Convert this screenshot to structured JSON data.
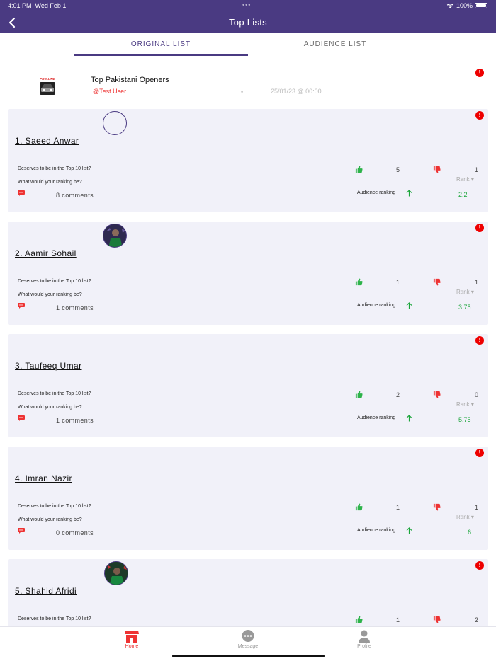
{
  "status": {
    "time": "4:01 PM",
    "date": "Wed Feb 1",
    "battery": "100%"
  },
  "header": {
    "title": "Top Lists"
  },
  "tabs": [
    {
      "label": "ORIGINAL LIST"
    },
    {
      "label": "AUDIENCE LIST"
    }
  ],
  "list": {
    "title": "Top Pakistani Openers",
    "user": "@Test User",
    "separator": "•",
    "date": "25/01/23 @ 00:00"
  },
  "labels": {
    "question1": "Deserves to be in the Top 10 list?",
    "question2": "What would your ranking be?",
    "rank": "Rank ▾",
    "audience_ranking": "Audience ranking"
  },
  "cards": [
    {
      "name": "1. Saeed Anwar",
      "likes": "5",
      "dislikes": "1",
      "comments": "8 comments",
      "score": "2.2"
    },
    {
      "name": "2. Aamir Sohail",
      "likes": "1",
      "dislikes": "1",
      "comments": "1 comments",
      "score": "3.75"
    },
    {
      "name": "3. Taufeeq Umar",
      "likes": "2",
      "dislikes": "0",
      "comments": "1 comments",
      "score": "5.75"
    },
    {
      "name": "4. Imran Nazir",
      "likes": "1",
      "dislikes": "1",
      "comments": "0 comments",
      "score": "6"
    },
    {
      "name": "5. Shahid Afridi",
      "likes": "1",
      "dislikes": "2",
      "comments": "",
      "score": ""
    }
  ],
  "nav": [
    {
      "label": "Home"
    },
    {
      "label": "Message"
    },
    {
      "label": "Profile"
    }
  ],
  "colors": {
    "header": "#4a3a82",
    "accent": "#e33333",
    "positive": "#1aa53a",
    "card": "#f1f1f9"
  }
}
